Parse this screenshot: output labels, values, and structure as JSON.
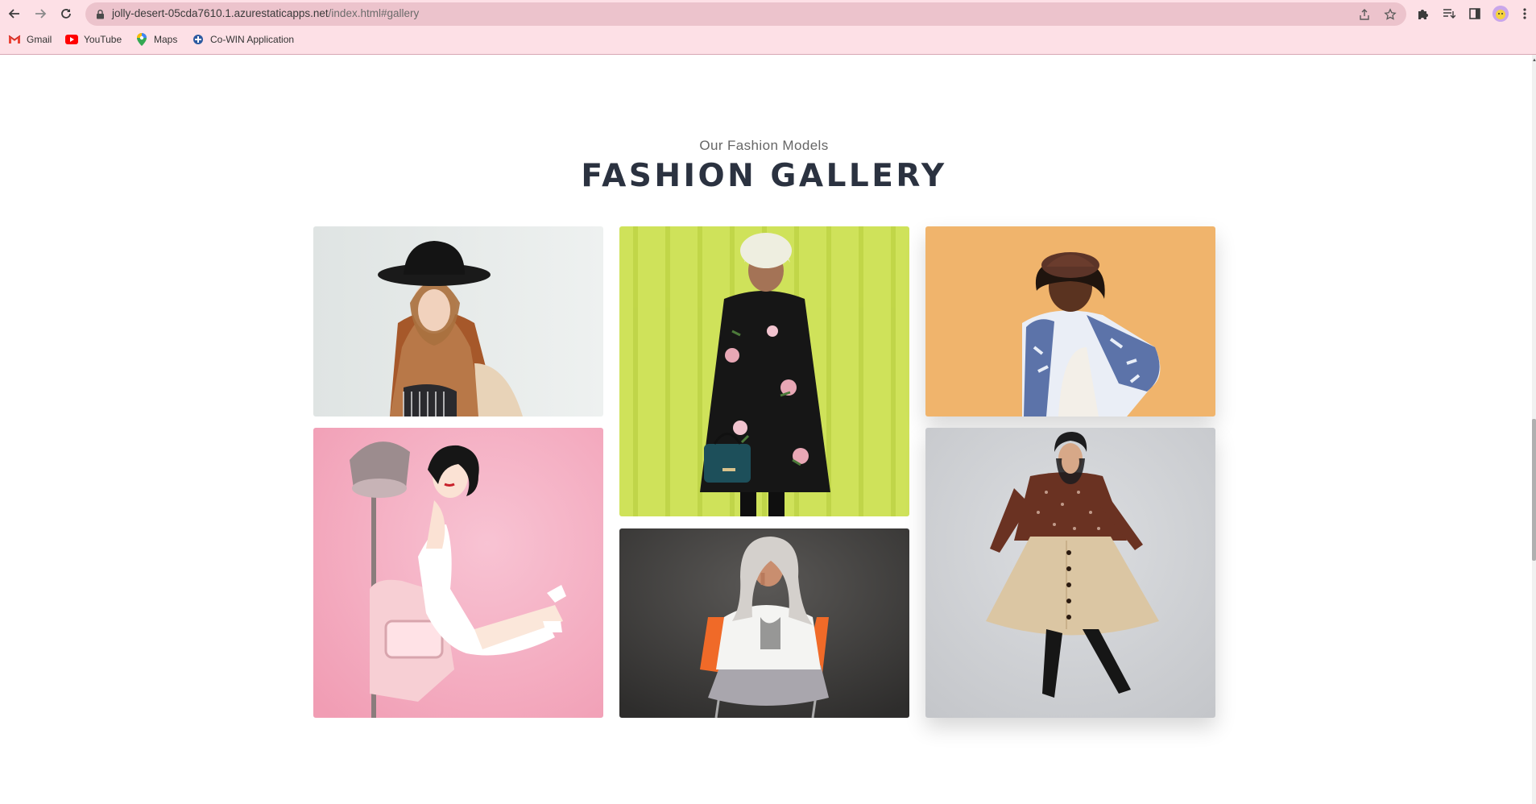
{
  "browser": {
    "url_host": "jolly-desert-05cda7610.1.azurestaticapps.net",
    "url_path": "/index.html#gallery",
    "bookmarks": [
      {
        "label": "Gmail",
        "icon": "gmail-icon"
      },
      {
        "label": "YouTube",
        "icon": "youtube-icon"
      },
      {
        "label": "Maps",
        "icon": "maps-icon"
      },
      {
        "label": "Co-WIN Application",
        "icon": "cowin-icon"
      }
    ]
  },
  "gallery": {
    "subtitle": "Our Fashion Models",
    "title": "FASHION GALLERY",
    "photos": [
      {
        "name": "model-brown-hijab-black-hat",
        "bg": "#e6eae9"
      },
      {
        "name": "model-floral-coat-green-backdrop",
        "bg": "#cde15a"
      },
      {
        "name": "model-brown-cap-orange-backdrop",
        "bg": "#f0b36b"
      },
      {
        "name": "model-pink-salon-chair",
        "bg": "#f4a9bd"
      },
      {
        "name": "model-white-hijab-orange-chair",
        "bg": "#454342"
      },
      {
        "name": "model-polka-dot-blouse-skirt",
        "bg": "#cfd1d4"
      }
    ]
  }
}
